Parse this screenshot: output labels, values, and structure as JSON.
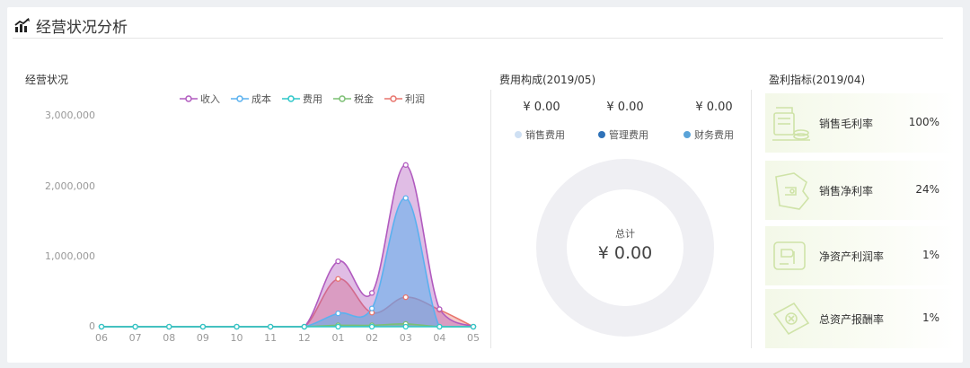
{
  "header": {
    "title": "经营状况分析",
    "icon": "bar-chart-trend-icon"
  },
  "operations": {
    "title": "经营状况",
    "chart_data": {
      "type": "area",
      "x": [
        "06",
        "07",
        "08",
        "09",
        "10",
        "11",
        "12",
        "01",
        "02",
        "03",
        "04",
        "05"
      ],
      "y_ticks": [
        "3,000,000",
        "2,000,000",
        "1,000,000",
        "0"
      ],
      "ylim": [
        0,
        3000000
      ],
      "legend_position": "top",
      "series": [
        {
          "name": "收入",
          "color": "#b15bbf",
          "values": [
            0,
            0,
            0,
            0,
            0,
            0,
            0,
            930000,
            480000,
            2300000,
            250000,
            0
          ]
        },
        {
          "name": "成本",
          "color": "#5ab1ef",
          "values": [
            0,
            0,
            0,
            0,
            0,
            0,
            0,
            190000,
            260000,
            1830000,
            0,
            0
          ]
        },
        {
          "name": "费用",
          "color": "#2ec7c9",
          "values": [
            0,
            0,
            0,
            0,
            0,
            0,
            0,
            0,
            0,
            0,
            0,
            0
          ]
        },
        {
          "name": "税金",
          "color": "#7cbf74",
          "values": [
            0,
            0,
            0,
            0,
            0,
            0,
            0,
            20000,
            20000,
            40000,
            0,
            0
          ]
        },
        {
          "name": "利润",
          "color": "#e8756d",
          "values": [
            0,
            0,
            0,
            0,
            0,
            0,
            0,
            680000,
            200000,
            420000,
            240000,
            0
          ]
        }
      ]
    }
  },
  "costs": {
    "title": "费用构成(2019/05)",
    "items": [
      {
        "value": "¥ 0.00",
        "label": "销售费用",
        "color": "#cfe0f3"
      },
      {
        "value": "¥ 0.00",
        "label": "管理费用",
        "color": "#2f72b8"
      },
      {
        "value": "¥ 0.00",
        "label": "财务费用",
        "color": "#5aa3d8"
      }
    ],
    "total_label": "总计",
    "total_value": "¥ 0.00"
  },
  "profit": {
    "title": "盈利指标(2019/04)",
    "items": [
      {
        "label": "销售毛利率",
        "value": "100%",
        "icon": "cash-register-icon"
      },
      {
        "label": "销售净利率",
        "value": "24%",
        "icon": "wallet-icon"
      },
      {
        "label": "净资产利润率",
        "value": "1%",
        "icon": "bank-card-icon"
      },
      {
        "label": "总资产报酬率",
        "value": "1%",
        "icon": "money-note-icon"
      }
    ]
  }
}
